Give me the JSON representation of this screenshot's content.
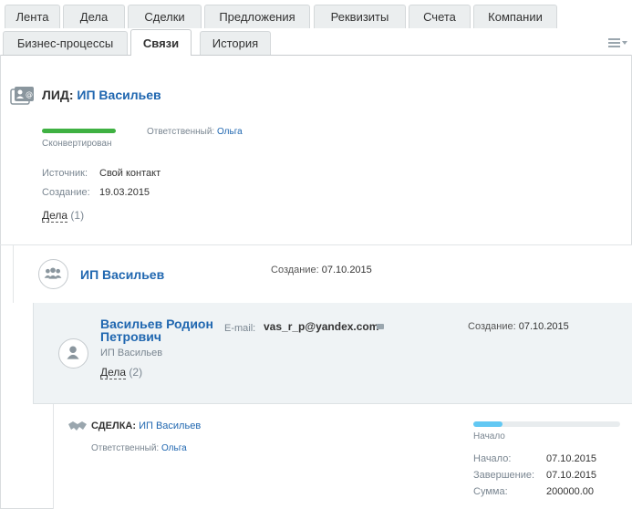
{
  "tabs": {
    "row1": [
      "Лента",
      "Дела",
      "Сделки",
      "Предложения",
      "Реквизиты",
      "Счета",
      "Компании"
    ],
    "row2": [
      "Бизнес-процессы",
      "Связи",
      "История"
    ],
    "active": "Связи"
  },
  "lead": {
    "type_label": "ЛИД:",
    "name": "ИП Васильев",
    "status": "Сконвертирован",
    "status_progress": 1.0,
    "responsible_label": "Ответственный:",
    "responsible": "Ольга",
    "source_label": "Источник:",
    "source": "Свой контакт",
    "created_label": "Создание:",
    "created": "19.03.2015",
    "deals_label": "Дела",
    "deals_count": "(1)"
  },
  "company": {
    "name": "ИП Васильев",
    "created_label": "Создание:",
    "created": "07.10.2015"
  },
  "contact": {
    "name": "Васильев Родион Петрович",
    "company": "ИП Васильев",
    "email_label": "E-mail:",
    "email": "vas_r_p@yandex.com",
    "created_label": "Создание:",
    "created": "07.10.2015",
    "deals_label": "Дела",
    "deals_count": "(2)"
  },
  "deal": {
    "type_label": "СДЕЛКА:",
    "name": "ИП Васильев",
    "responsible_label": "Ответственный:",
    "responsible": "Ольга",
    "stage": "Начало",
    "stage_progress": 0.2,
    "start_label": "Начало:",
    "start": "07.10.2015",
    "end_label": "Завершение:",
    "end": "07.10.2015",
    "sum_label": "Сумма:",
    "sum": "200000.00"
  },
  "colors": {
    "link": "#2067b0",
    "status_green": "#3fb142",
    "stage_blue": "#62c8f3",
    "contact_bg": "#eff3f5"
  },
  "icons": {
    "lead": "lead-card-icon",
    "company": "company-group-icon",
    "contact": "user-icon",
    "deal": "handshake-icon",
    "email": "mail-icon",
    "menu": "menu-icon"
  }
}
